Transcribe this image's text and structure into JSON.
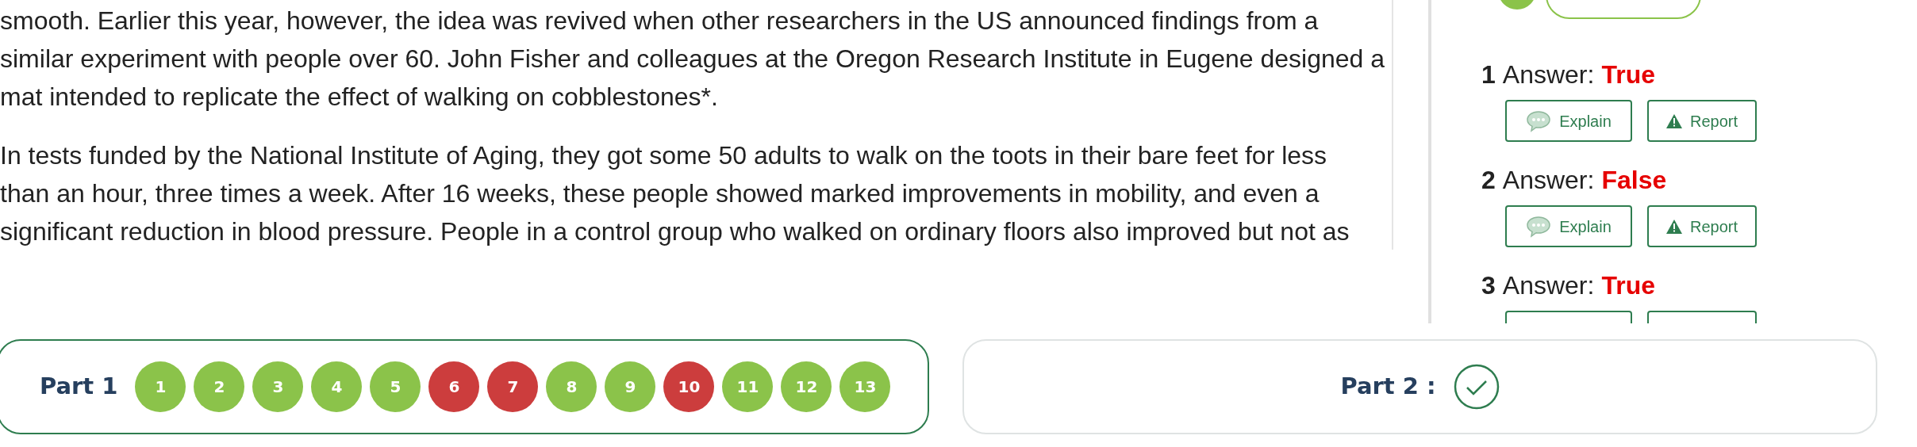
{
  "article": {
    "paragraphs": [
      {
        "lines": [
          "smooth. Earlier this year, however, the idea was revived when other researchers in the US announced findings from a",
          "similar experiment with people over 60. John Fisher and colleagues at the Oregon Research Institute in Eugene designed a",
          "mat intended to replicate the effect of walking on cobblestones*."
        ]
      },
      {
        "lines": [
          "In tests funded by the National Institute of Aging, they got some 50 adults to walk on the toots in their bare feet for less",
          "than an hour, three times a week. After 16 weeks, these people showed marked improvements in mobility, and even a",
          "significant reduction in blood pressure. People in a control group who walked on ordinary floors also improved but not as"
        ]
      }
    ]
  },
  "answers": [
    {
      "number": "1",
      "label": "Answer:",
      "answer": "True",
      "buttons": [
        "Explain",
        "Report"
      ]
    },
    {
      "number": "2",
      "label": "Answer:",
      "answer": "False",
      "buttons": [
        "Explain",
        "Report"
      ]
    },
    {
      "number": "3",
      "label": "Answer:",
      "answer": "True",
      "buttons_cut": true
    }
  ],
  "parts": [
    {
      "kind": "questions",
      "label": "Part 1",
      "selected": true,
      "questions": [
        {
          "label": "1",
          "correct": true
        },
        {
          "label": "2",
          "correct": true
        },
        {
          "label": "3",
          "correct": true
        },
        {
          "label": "4",
          "correct": true
        },
        {
          "label": "5",
          "correct": true
        },
        {
          "label": "6",
          "correct": false
        },
        {
          "label": "7",
          "correct": false
        },
        {
          "label": "8",
          "correct": true
        },
        {
          "label": "9",
          "correct": true
        },
        {
          "label": "10",
          "correct": false
        },
        {
          "label": "11",
          "correct": true
        },
        {
          "label": "12",
          "correct": true
        },
        {
          "label": "13",
          "correct": true
        }
      ]
    },
    {
      "kind": "done",
      "label": "Part 2 :",
      "selected": false
    }
  ]
}
